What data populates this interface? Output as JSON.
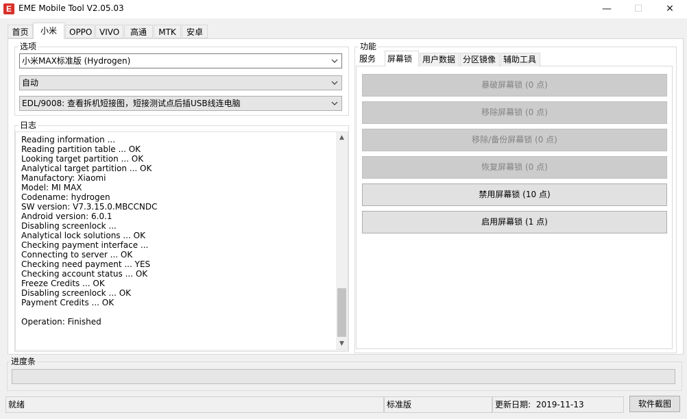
{
  "window": {
    "title": "EME Mobile Tool V2.05.03",
    "icon_letter": "E",
    "minimize_glyph": "—",
    "maximize_glyph": "☐",
    "close_glyph": "✕"
  },
  "top_tabs": [
    {
      "label": "首页"
    },
    {
      "label": "小米",
      "active": true
    },
    {
      "label": "OPPO"
    },
    {
      "label": "VIVO"
    },
    {
      "label": "高通"
    },
    {
      "label": "MTK"
    },
    {
      "label": "安卓"
    }
  ],
  "options": {
    "title": "选项",
    "model_select": "小米MAX标准版 (Hydrogen)",
    "mode_select": "自动",
    "port_select": "EDL/9008: 查看拆机短接图，短接测试点后插USB线连电脑"
  },
  "log": {
    "title": "日志",
    "lines": [
      "Reading information ...",
      "Reading partition table ... OK",
      "Looking target partition ... OK",
      "Analytical target partition ... OK",
      "Manufactory: Xiaomi",
      "Model: MI MAX",
      "Codename: hydrogen",
      "SW version: V7.3.15.0.MBCCNDC",
      "Android version: 6.0.1",
      "Disabling screenlock ...",
      "Analytical lock solutions ... OK",
      "Checking payment interface ...",
      "Connecting to server ... OK",
      "Checking need payment ... YES",
      "Checking account status ... OK",
      "Freeze Credits ... OK",
      "Disabling screenlock ... OK",
      "Payment Credits ... OK",
      "",
      "Operation: Finished"
    ]
  },
  "functions": {
    "title": "功能",
    "tabs": [
      {
        "label": "服务"
      },
      {
        "label": "屏幕锁",
        "active": true
      },
      {
        "label": "用户数据"
      },
      {
        "label": "分区镜像"
      },
      {
        "label": "辅助工具"
      }
    ],
    "buttons": [
      {
        "label": "暴破屏幕锁 (0 点)",
        "enabled": false
      },
      {
        "label": "移除屏幕锁 (0 点)",
        "enabled": false
      },
      {
        "label": "移除/备份屏幕锁 (0 点)",
        "enabled": false
      },
      {
        "label": "恢复屏幕锁 (0 点)",
        "enabled": false
      },
      {
        "label": "禁用屏幕锁 (10 点)",
        "enabled": true
      },
      {
        "label": "启用屏幕锁 (1 点)",
        "enabled": true
      }
    ]
  },
  "progress": {
    "title": "进度条",
    "value": 0
  },
  "status_bar": {
    "state": "就绪",
    "edition": "标准版",
    "update_label": "更新日期:",
    "update_date": "2019-11-13",
    "screenshot_button": "软件截图"
  },
  "colors": {
    "app_icon": "#d8302a",
    "progress_fill": "#06b025"
  }
}
